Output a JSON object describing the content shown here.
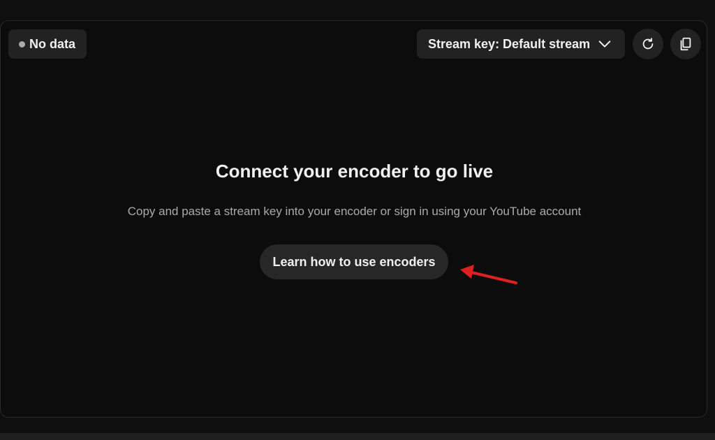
{
  "status": {
    "label": "No data",
    "dot_color": "#aaaaaa"
  },
  "stream_key": {
    "label": "Stream key: Default stream",
    "icon": "chevron-down-icon"
  },
  "toolbar": {
    "refresh_icon": "refresh-icon",
    "copy_icon": "copy-icon"
  },
  "main": {
    "title": "Connect your encoder to go live",
    "description": "Copy and paste a stream key into your encoder or sign in using your YouTube account",
    "learn_button": "Learn how to use encoders"
  },
  "annotation": {
    "arrow_color": "#e02020"
  },
  "colors": {
    "background": "#0f0f0f",
    "panel": "#0c0c0c",
    "chip": "#222222",
    "text_primary": "#f1f1f1",
    "text_secondary": "#aaaaaa"
  }
}
